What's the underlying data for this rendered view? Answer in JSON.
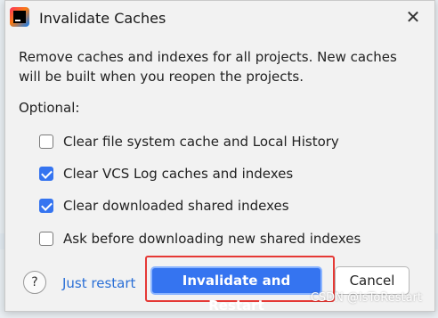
{
  "dialog": {
    "title": "Invalidate Caches",
    "close_glyph": "✕",
    "description": "Remove caches and indexes for all projects. New caches will be built when you reopen the projects.",
    "optional_label": "Optional:",
    "options": [
      {
        "label": "Clear file system cache and Local History",
        "checked": false
      },
      {
        "label": "Clear VCS Log caches and indexes",
        "checked": true
      },
      {
        "label": "Clear downloaded shared indexes",
        "checked": true
      },
      {
        "label": "Ask before downloading new shared indexes",
        "checked": false
      }
    ],
    "help_glyph": "?",
    "just_restart_label": "Just restart",
    "primary_label": "Invalidate and Restart",
    "cancel_label": "Cancel"
  },
  "watermark": "CSDN @IsToRestart",
  "colors": {
    "accent": "#3574f0",
    "highlight_border": "#e53935",
    "link": "#2a6fd6"
  }
}
